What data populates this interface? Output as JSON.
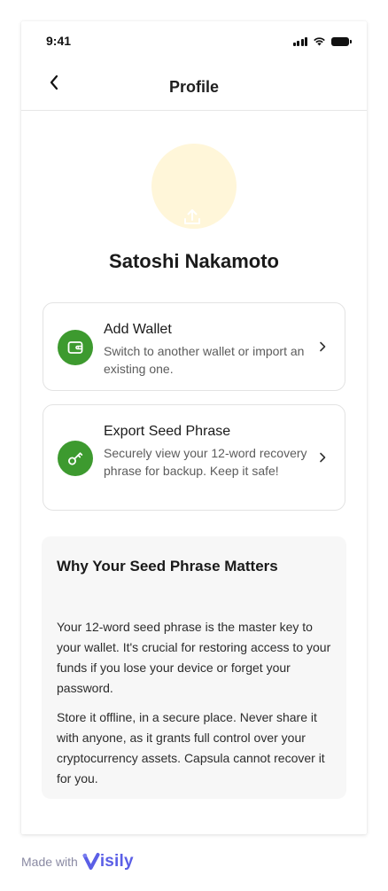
{
  "status_bar": {
    "time": "9:41"
  },
  "header": {
    "title": "Profile"
  },
  "profile": {
    "name": "Satoshi Nakamoto"
  },
  "actions": [
    {
      "title": "Add Wallet",
      "description": "Switch to another wallet or import an existing one.",
      "icon": "wallet-icon"
    },
    {
      "title": "Export Seed Phrase",
      "description": "Securely view your 12-word recovery phrase for backup. Keep it safe!",
      "icon": "key-icon"
    }
  ],
  "info": {
    "title": "Why Your Seed Phrase Matters",
    "paragraphs": [
      "Your 12-word seed phrase is the master key to your wallet. It's crucial for restoring access to your funds if you lose your device or forget your password.",
      "Store it offline, in a secure place. Never share it with anyone, as it grants full control over your cryptocurrency assets. Capsula cannot recover it for you."
    ]
  },
  "footer": {
    "made_with": "Made with",
    "brand": "isily",
    "brand_initial": "V"
  },
  "colors": {
    "accent_green": "#3d9a2f",
    "avatar_bg": "#fff6d9",
    "panel_bg": "#f7f7f7",
    "brand_purple": "#5b5fe6"
  }
}
